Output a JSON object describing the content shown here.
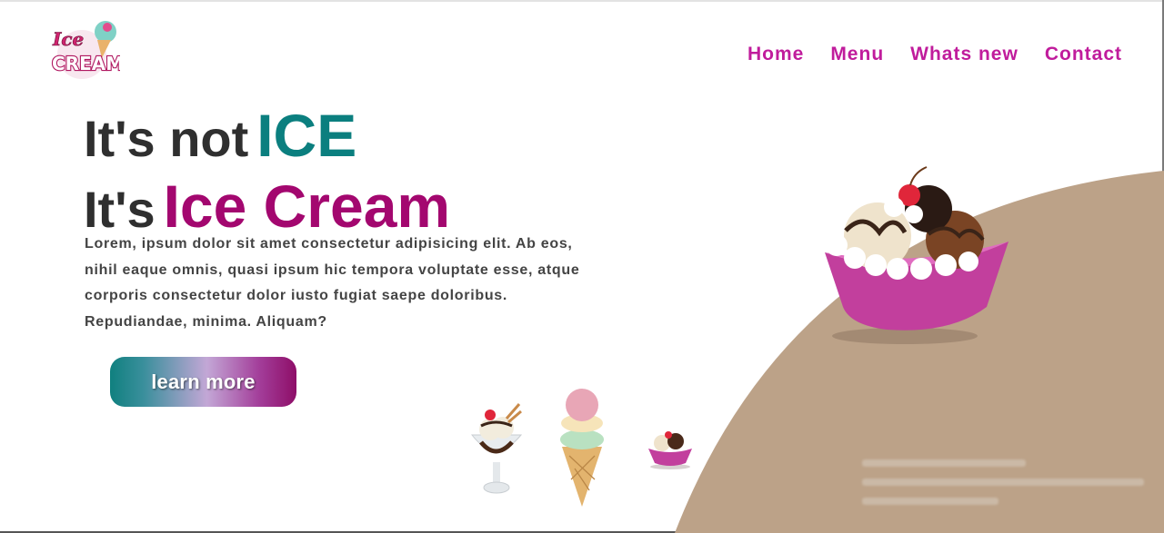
{
  "brand": {
    "logo_text": "Ice Cream"
  },
  "nav": {
    "items": [
      {
        "label": "Home"
      },
      {
        "label": "Menu"
      },
      {
        "label": "Whats new"
      },
      {
        "label": "Contact"
      }
    ]
  },
  "hero": {
    "line1_prefix": "It's not",
    "line1_highlight": "ICE",
    "line2_prefix": "It's",
    "line2_highlight": "Ice Cream",
    "description": "Lorem, ipsum dolor sit amet consectetur adipisicing elit. Ab eos, nihil eaque omnis, quasi ipsum hic tempora voluptate esse, atque corporis consectetur dolor iusto fugiat saepe doloribus. Repudiandae, minima. Aliquam?",
    "cta_label": "learn more"
  },
  "colors": {
    "accent_magenta": "#c01c9c",
    "headline_teal": "#0b7f7f",
    "headline_magenta": "#a3076f",
    "background_tan": "#bca288"
  },
  "icons": {
    "logo": "ice-cream-logo",
    "main_product": "ice-cream-bowl",
    "thumb_1": "sundae-glass",
    "thumb_2": "ice-cream-cone",
    "thumb_3": "small-ice-cream-bowl"
  }
}
